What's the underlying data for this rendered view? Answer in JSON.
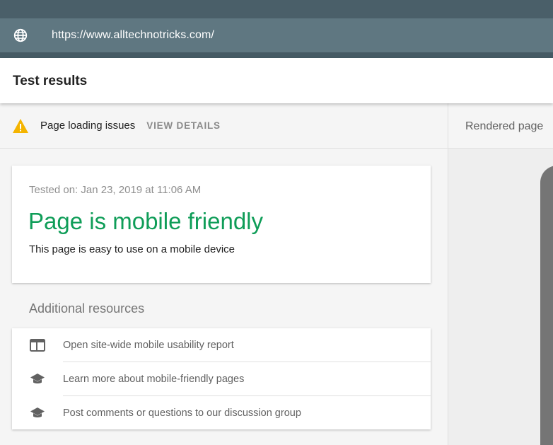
{
  "urlbar": {
    "icon": "globe-icon",
    "url": "https://www.alltechnotricks.com/"
  },
  "header": {
    "title": "Test results"
  },
  "issues": {
    "icon": "warning-icon",
    "label": "Page loading issues",
    "action": "VIEW DETAILS",
    "warning_color": "#f4b400"
  },
  "result": {
    "tested_on": "Tested on: Jan 23, 2019 at 11:06 AM",
    "verdict": "Page is mobile friendly",
    "description": "This page is easy to use on a mobile device",
    "verdict_color": "#0f9d58"
  },
  "additional": {
    "heading": "Additional resources",
    "items": [
      {
        "icon": "report-icon",
        "label": "Open site-wide mobile usability report"
      },
      {
        "icon": "school-icon",
        "label": "Learn more about mobile-friendly pages"
      },
      {
        "icon": "school-icon",
        "label": "Post comments or questions to our discussion group"
      }
    ]
  },
  "right": {
    "tab": "Rendered page"
  }
}
